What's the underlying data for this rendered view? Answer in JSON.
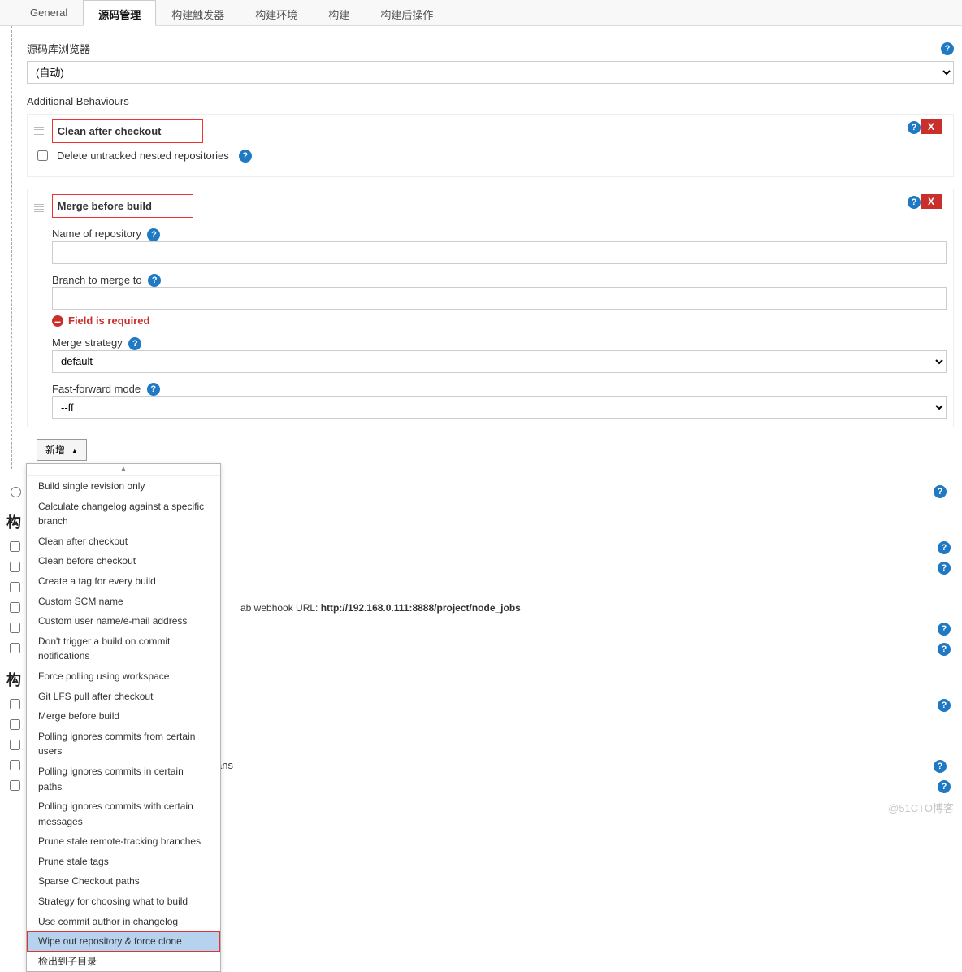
{
  "tabs": {
    "items": [
      "General",
      "源码管理",
      "构建触发器",
      "构建环境",
      "构建",
      "构建后操作"
    ],
    "active_index": 1
  },
  "repo_browser": {
    "label": "源码库浏览器",
    "value": "(自动)"
  },
  "additional_label": "Additional Behaviours",
  "behaviour1": {
    "title": "Clean after checkout",
    "delete": "X",
    "opt_label": "Delete untracked nested repositories"
  },
  "behaviour2": {
    "title": "Merge before build",
    "delete": "X",
    "name_label": "Name of repository",
    "branch_label": "Branch to merge to",
    "error": "Field is required",
    "strategy_label": "Merge strategy",
    "strategy_value": "default",
    "ff_label": "Fast-forward mode",
    "ff_value": "--ff"
  },
  "add_button": "新增",
  "dropdown_items": [
    "Build single revision only",
    "Calculate changelog against a specific branch",
    "Clean after checkout",
    "Clean before checkout",
    "Create a tag for every build",
    "Custom SCM name",
    "Custom user name/e-mail address",
    "Don't trigger a build on commit notifications",
    "Force polling using workspace",
    "Git LFS pull after checkout",
    "Merge before build",
    "Polling ignores commits from certain users",
    "Polling ignores commits in certain paths",
    "Polling ignores commits with certain messages",
    "Prune stale remote-tracking branches",
    "Prune stale tags",
    "Sparse Checkout paths",
    "Strategy for choosing what to build",
    "Use commit author in changelog",
    "Wipe out repository & force clone",
    "检出到子目录"
  ],
  "dropdown_highlight_index": 19,
  "lower": {
    "radio_row": "",
    "section1": "构",
    "webhook_text_prefix": "ab webhook URL: ",
    "webhook_url": "http://192.168.0.111:8888/project/node_jobs",
    "row_ans": "ans",
    "section2": "构"
  },
  "watermark": "@51CTO博客"
}
